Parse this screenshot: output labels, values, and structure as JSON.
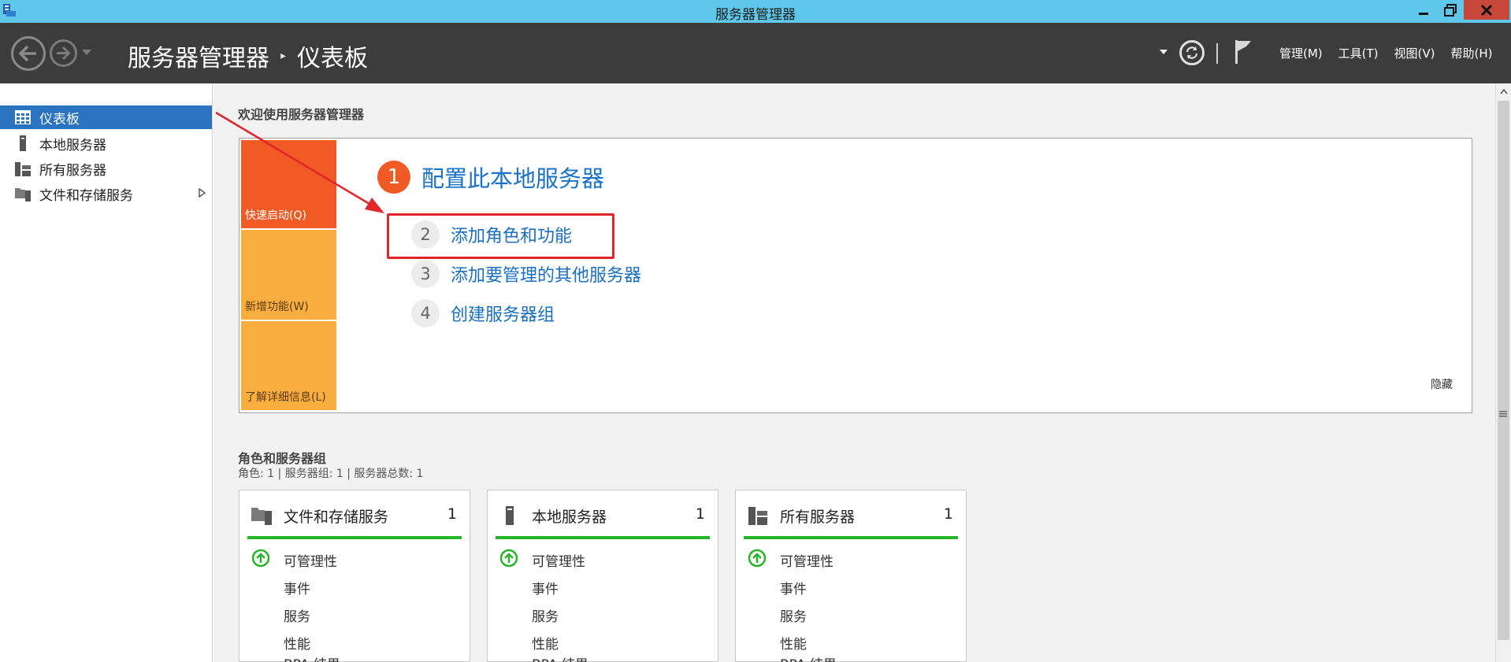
{
  "window": {
    "title": "服务器管理器"
  },
  "header": {
    "breadcrumb_root": "服务器管理器",
    "breadcrumb_current": "仪表板",
    "menus": [
      "管理(M)",
      "工具(T)",
      "视图(V)",
      "帮助(H)"
    ]
  },
  "sidebar": {
    "items": [
      {
        "label": "仪表板",
        "icon": "dashboard-grid-icon",
        "active": true
      },
      {
        "label": "本地服务器",
        "icon": "server-tower-icon",
        "active": false
      },
      {
        "label": "所有服务器",
        "icon": "servers-icon",
        "active": false
      },
      {
        "label": "文件和存储服务",
        "icon": "file-storage-icon",
        "active": false,
        "expandable": true
      }
    ]
  },
  "welcome": {
    "title": "欢迎使用服务器管理器",
    "tiles": [
      "快速启动(Q)",
      "新增功能(W)",
      "了解详细信息(L)"
    ],
    "steps": [
      {
        "num": "1",
        "label": "配置此本地服务器"
      },
      {
        "num": "2",
        "label": "添加角色和功能"
      },
      {
        "num": "3",
        "label": "添加要管理的其他服务器"
      },
      {
        "num": "4",
        "label": "创建服务器组"
      }
    ],
    "hide": "隐藏"
  },
  "roles": {
    "title": "角色和服务器组",
    "summary": "角色: 1 | 服务器组: 1 | 服务器总数: 1",
    "cards": [
      {
        "name": "文件和存储服务",
        "count": "1",
        "icon": "file-storage-icon",
        "rows": [
          "可管理性",
          "事件",
          "服务",
          "性能",
          "BPA 结果"
        ]
      },
      {
        "name": "本地服务器",
        "count": "1",
        "icon": "server-tower-icon",
        "rows": [
          "可管理性",
          "事件",
          "服务",
          "性能",
          "BPA 结果"
        ]
      },
      {
        "name": "所有服务器",
        "count": "1",
        "icon": "servers-icon",
        "rows": [
          "可管理性",
          "事件",
          "服务",
          "性能",
          "BPA 结果"
        ]
      }
    ]
  },
  "colors": {
    "titlebar": "#5fc8ea",
    "header": "#3c3c3c",
    "active_nav": "#2a73c1",
    "quick_start": "#f15a25",
    "tile_secondary": "#fbae40",
    "link": "#1a73c8",
    "status_ok": "#27b52a",
    "annotation": "#e0252b"
  }
}
